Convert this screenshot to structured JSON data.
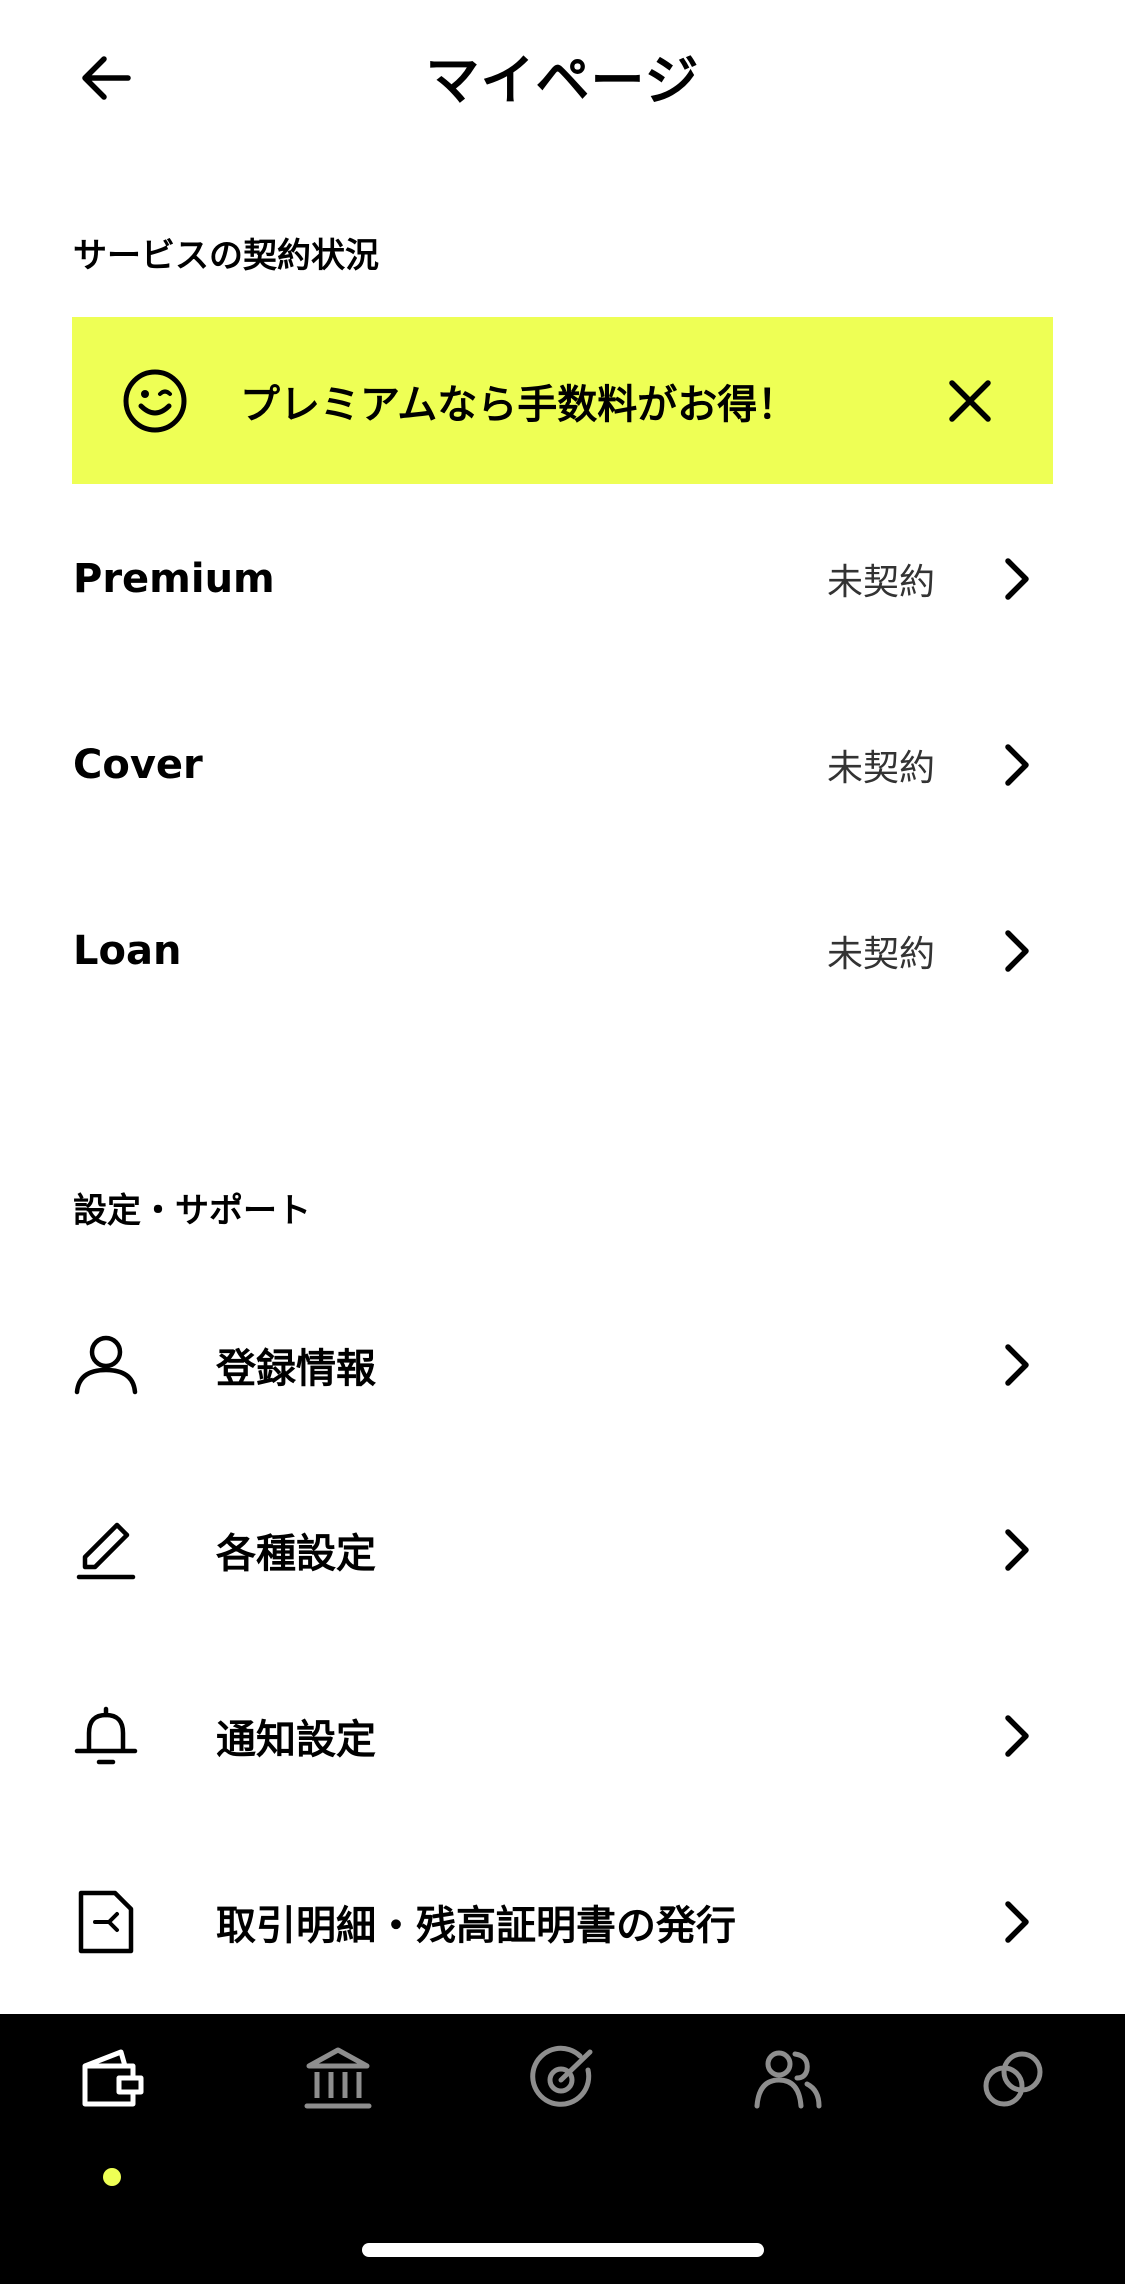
{
  "header": {
    "title": "マイページ",
    "back_icon": "arrow-left-icon"
  },
  "services_section": {
    "title": "サービスの契約状況",
    "banner": {
      "text": "プレミアムなら手数料がお得！",
      "icon": "smile-icon",
      "close_icon": "close-icon",
      "background": "#EEFF55"
    },
    "items": [
      {
        "name": "Premium",
        "status": "未契約"
      },
      {
        "name": "Cover",
        "status": "未契約"
      },
      {
        "name": "Loan",
        "status": "未契約"
      }
    ]
  },
  "settings_section": {
    "title": "設定・サポート",
    "items": [
      {
        "label": "登録情報",
        "icon": "user-icon"
      },
      {
        "label": "各種設定",
        "icon": "pencil-icon"
      },
      {
        "label": "通知設定",
        "icon": "bell-icon"
      },
      {
        "label": "取引明細・残高証明書の発行",
        "icon": "document-icon"
      }
    ]
  },
  "tabbar": {
    "background": "#000000",
    "active_color": "#FFFFFF",
    "inactive_color": "#8E8E8E",
    "indicator_color": "#EEFF55",
    "tabs": [
      {
        "icon": "wallet-icon",
        "active": true
      },
      {
        "icon": "bank-icon",
        "active": false
      },
      {
        "icon": "target-icon",
        "active": false
      },
      {
        "icon": "people-icon",
        "active": false
      },
      {
        "icon": "link-icon",
        "active": false
      }
    ]
  }
}
